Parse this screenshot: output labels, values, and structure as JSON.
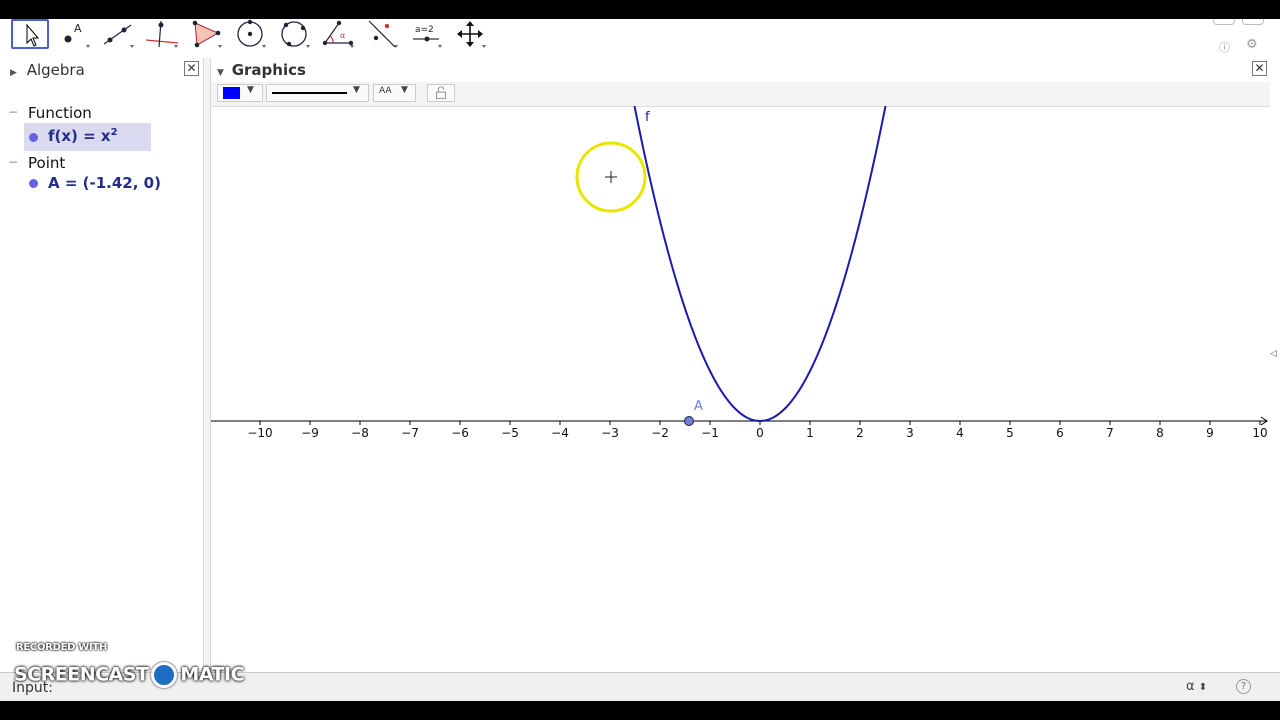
{
  "toolbar": {
    "tools": [
      {
        "name": "move-tool",
        "selected": true
      },
      {
        "name": "point-tool"
      },
      {
        "name": "line-tool"
      },
      {
        "name": "perpendicular-line-tool"
      },
      {
        "name": "polygon-tool"
      },
      {
        "name": "circle-tool"
      },
      {
        "name": "conic-tool"
      },
      {
        "name": "angle-tool"
      },
      {
        "name": "reflect-tool"
      },
      {
        "name": "slider-tool",
        "label": "a=2"
      },
      {
        "name": "move-graphics-view-tool"
      }
    ]
  },
  "algebra": {
    "title": "Algebra",
    "categories": [
      {
        "label": "Function",
        "items": [
          {
            "label": "f(x) = x",
            "superscript": "2",
            "selected": true
          }
        ]
      },
      {
        "label": "Point",
        "items": [
          {
            "label": "A = (-1.42, 0)",
            "selected": false
          }
        ]
      }
    ]
  },
  "graphics": {
    "title": "Graphics",
    "curve_label": "f",
    "point_label": "A",
    "point_x": -1.42,
    "x_ticks": [
      "-10",
      "-9",
      "-8",
      "-7",
      "-6",
      "-5",
      "-4",
      "-3",
      "-2",
      "-1",
      "0",
      "1",
      "2",
      "3",
      "4",
      "5",
      "6",
      "7",
      "8",
      "9",
      "10"
    ],
    "x_range": [
      -11,
      10.2
    ],
    "style_bar": {
      "color": "#0000ff",
      "font_label": "AA"
    }
  },
  "input_bar": {
    "label": "Input:",
    "alpha_symbol": "α"
  },
  "watermark": {
    "small": "RECORDED WITH",
    "big_left": "SCREENCAST",
    "big_right": "MATIC"
  },
  "colors": {
    "curve": "#1a1ab0",
    "point": "#6f7fd6",
    "selection": "#d9d9ef",
    "highlight": "#e6e600"
  }
}
